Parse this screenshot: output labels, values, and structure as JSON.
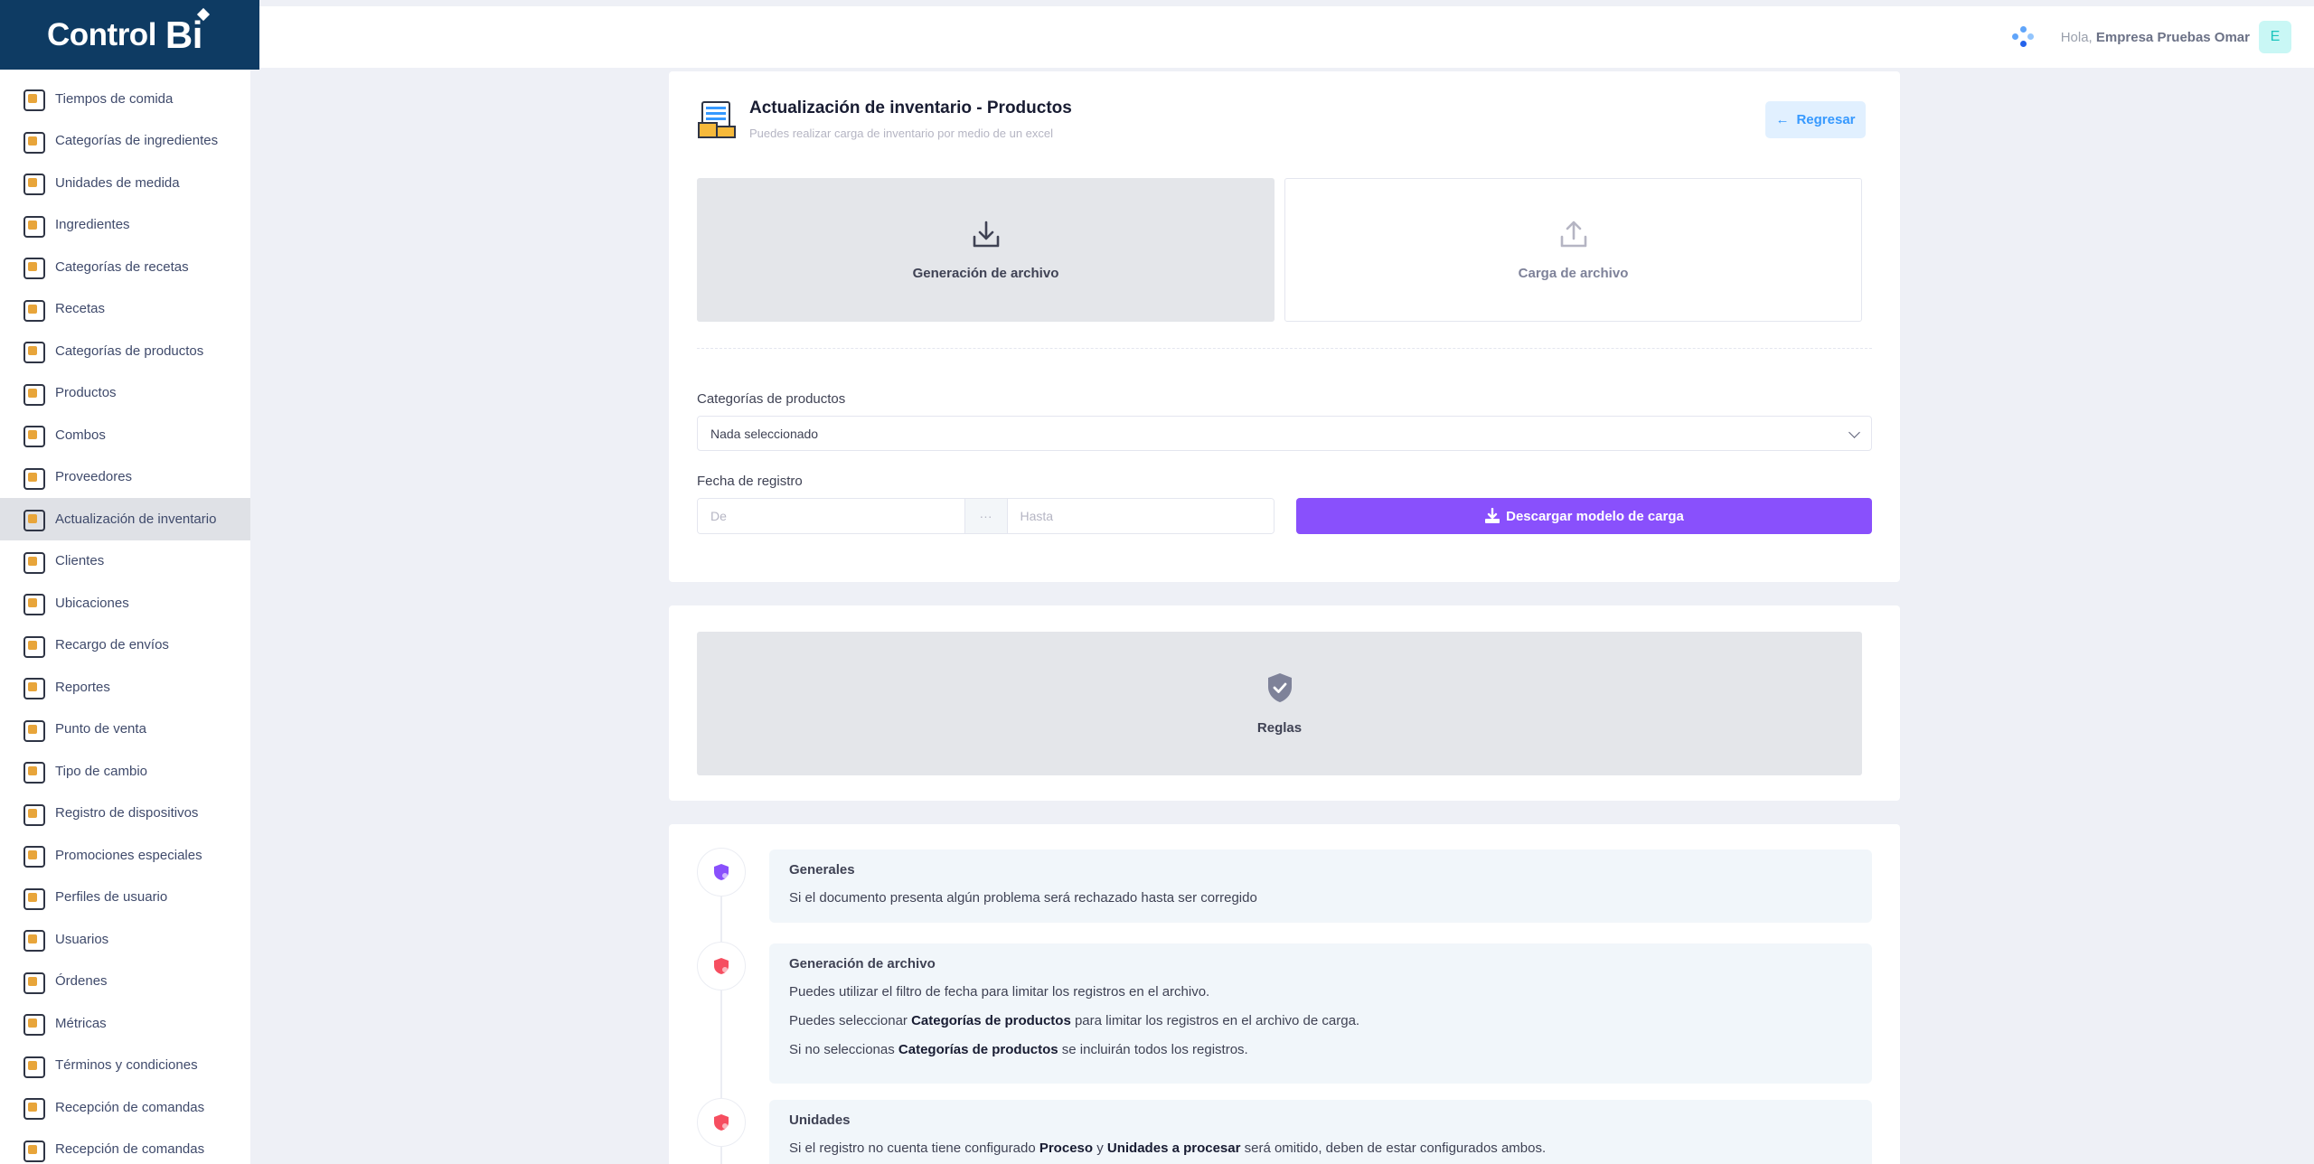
{
  "brand": {
    "name": "Control",
    "mark": "Bi"
  },
  "header": {
    "greeting": "Hola,",
    "user_name": "Empresa Pruebas Omar",
    "avatar_letter": "E"
  },
  "sidebar": {
    "items": [
      {
        "label": "Tiempos de comida",
        "icon": "clock-icon",
        "active": false
      },
      {
        "label": "Categorías de ingredientes",
        "icon": "ingredients-category-icon",
        "active": false
      },
      {
        "label": "Unidades de medida",
        "icon": "scale-icon",
        "active": false
      },
      {
        "label": "Ingredientes",
        "icon": "jar-icon",
        "active": false
      },
      {
        "label": "Categorías de recetas",
        "icon": "recipe-category-icon",
        "active": false
      },
      {
        "label": "Recetas",
        "icon": "recipe-icon",
        "active": false
      },
      {
        "label": "Categorías de productos",
        "icon": "product-category-icon",
        "active": false
      },
      {
        "label": "Productos",
        "icon": "product-icon",
        "active": false
      },
      {
        "label": "Combos",
        "icon": "combo-icon",
        "active": false
      },
      {
        "label": "Proveedores",
        "icon": "supplier-icon",
        "active": false
      },
      {
        "label": "Actualización de inventario",
        "icon": "inventory-icon",
        "active": true
      },
      {
        "label": "Clientes",
        "icon": "clients-icon",
        "active": false
      },
      {
        "label": "Ubicaciones",
        "icon": "location-icon",
        "active": false
      },
      {
        "label": "Recargo de envíos",
        "icon": "delivery-icon",
        "active": false
      },
      {
        "label": "Reportes",
        "icon": "reports-icon",
        "active": false
      },
      {
        "label": "Punto de venta",
        "icon": "pos-icon",
        "active": false
      },
      {
        "label": "Tipo de cambio",
        "icon": "exchange-icon",
        "active": false
      },
      {
        "label": "Registro de dispositivos",
        "icon": "devices-icon",
        "active": false
      },
      {
        "label": "Promociones especiales",
        "icon": "promo-icon",
        "active": false
      },
      {
        "label": "Perfiles de usuario",
        "icon": "profile-icon",
        "active": false
      },
      {
        "label": "Usuarios",
        "icon": "users-icon",
        "active": false
      },
      {
        "label": "Órdenes",
        "icon": "orders-icon",
        "active": false
      },
      {
        "label": "Métricas",
        "icon": "metrics-icon",
        "active": false
      },
      {
        "label": "Términos y condiciones",
        "icon": "terms-icon",
        "active": false
      },
      {
        "label": "Recepción de comandas",
        "icon": "kitchen-icon",
        "active": false
      },
      {
        "label": "Recepción de comandas",
        "icon": "kitchen-icon",
        "active": false
      }
    ]
  },
  "page": {
    "title": "Actualización de inventario - Productos",
    "subtitle": "Puedes realizar carga de inventario por medio de un excel",
    "back_label": "Regresar"
  },
  "tabs": {
    "generate": "Generación de archivo",
    "upload": "Carga de archivo"
  },
  "form": {
    "category_label": "Categorías de productos",
    "category_value": "Nada seleccionado",
    "date_label": "Fecha de registro",
    "date_from_placeholder": "De",
    "date_sep": "···",
    "date_to_placeholder": "Hasta",
    "download_label": "Descargar modelo de carga"
  },
  "rules": {
    "label": "Reglas"
  },
  "timeline": [
    {
      "title": "Generales",
      "color": "#8950fc",
      "lines": [
        [
          {
            "t": "Si el documento presenta algún problema será rechazado hasta ser corregido"
          }
        ]
      ]
    },
    {
      "title": "Generación de archivo",
      "color": "#f64e60",
      "lines": [
        [
          {
            "t": "Puedes utilizar el filtro de fecha para limitar los registros en el archivo."
          }
        ],
        [
          {
            "t": "Puedes seleccionar "
          },
          {
            "t": "Categorías de productos",
            "b": true
          },
          {
            "t": " para limitar los registros en el archivo de carga."
          }
        ],
        [
          {
            "t": "Si no seleccionas "
          },
          {
            "t": "Categorías de productos",
            "b": true
          },
          {
            "t": " se incluirán todos los registros."
          }
        ]
      ]
    },
    {
      "title": "Unidades",
      "color": "#f64e60",
      "lines": [
        [
          {
            "t": "Si el registro no cuenta tiene configurado "
          },
          {
            "t": "Proceso",
            "b": true
          },
          {
            "t": " y "
          },
          {
            "t": "Unidades a procesar",
            "b": true
          },
          {
            "t": " será omitido, deben de estar configurados ambos."
          }
        ]
      ]
    }
  ],
  "colors": {
    "brand": "#0e3b63",
    "primary": "#8950fc",
    "info": "#3699ff",
    "danger": "#f64e60"
  }
}
